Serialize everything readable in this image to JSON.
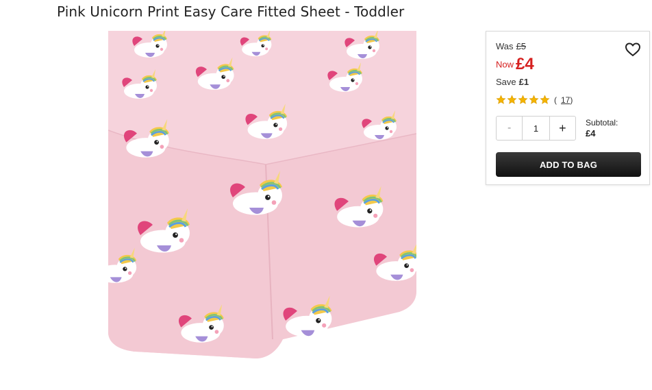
{
  "product": {
    "title": "Pink Unicorn Print Easy Care Fitted Sheet - Toddler"
  },
  "pricing": {
    "was_label": "Was",
    "was_amount": "£5",
    "now_label": "Now",
    "now_amount": "£4",
    "save_label": "Save",
    "save_amount": "£1"
  },
  "rating": {
    "stars": 5,
    "reviews_text": "17"
  },
  "quantity": {
    "minus": "-",
    "value": "1",
    "plus": "+"
  },
  "subtotal": {
    "label": "Subtotal:",
    "amount": "£4"
  },
  "actions": {
    "add_to_bag": "ADD TO BAG"
  },
  "colors": {
    "sheet_pink": "#f6d3dc",
    "price_red": "#d6201f",
    "star_gold": "#f4b400",
    "button_dark": "#1b1b1b"
  },
  "icons": {
    "wishlist": "heart-outline-icon",
    "star": "star-icon"
  }
}
